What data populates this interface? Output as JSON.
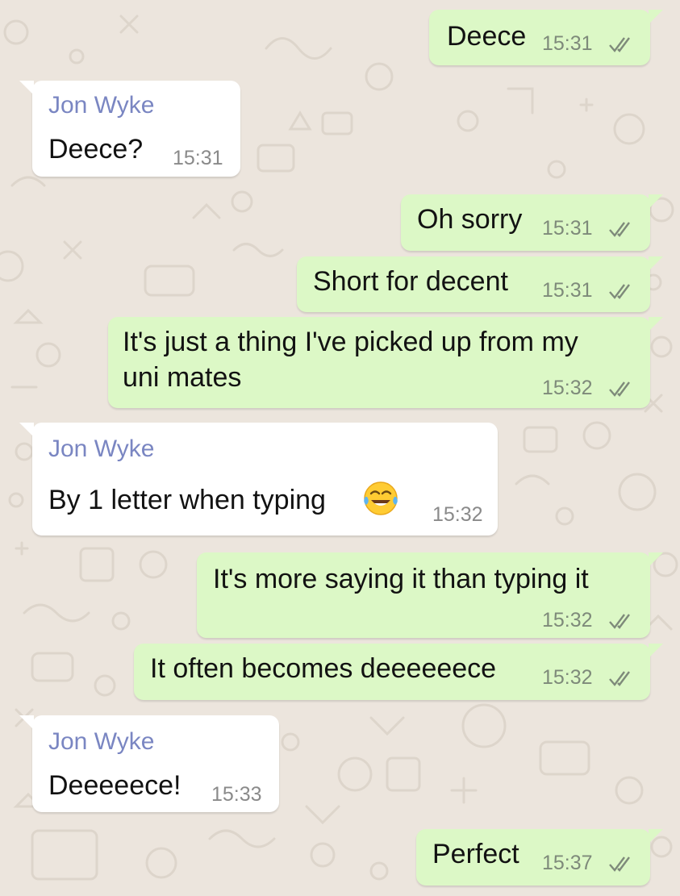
{
  "chat": {
    "contact_name": "Jon Wyke",
    "messages": [
      {
        "direction": "out",
        "text": "Deece",
        "time": "15:31"
      },
      {
        "direction": "in",
        "sender": "Jon Wyke",
        "text": "Deece?",
        "time": "15:31"
      },
      {
        "direction": "out",
        "text": "Oh sorry",
        "time": "15:31"
      },
      {
        "direction": "out",
        "text": "Short for decent",
        "time": "15:31"
      },
      {
        "direction": "out",
        "text_line1": "It's just a thing I've picked up from my",
        "text_line2": "uni mates",
        "time": "15:32"
      },
      {
        "direction": "in",
        "sender": "Jon Wyke",
        "text": "By 1 letter when typing",
        "emoji": "face-with-tears-of-joy",
        "time": "15:32"
      },
      {
        "direction": "out",
        "text": "It's more saying it than typing it",
        "time": "15:32"
      },
      {
        "direction": "out",
        "text": "It often becomes deeeeeece",
        "time": "15:32"
      },
      {
        "direction": "in",
        "sender": "Jon Wyke",
        "text": "Deeeeece!",
        "time": "15:33"
      },
      {
        "direction": "out",
        "text": "Perfect",
        "time": "15:37"
      }
    ]
  },
  "colors": {
    "background": "#ECE5DD",
    "outgoing_bubble": "#DCF8C6",
    "incoming_bubble": "#FFFFFF",
    "sender_name": "#7A86C2",
    "read_ticks": "#7e8a7a"
  },
  "icons": {
    "read_receipt": "double-check-icon",
    "emoji": "face-with-tears-of-joy"
  }
}
